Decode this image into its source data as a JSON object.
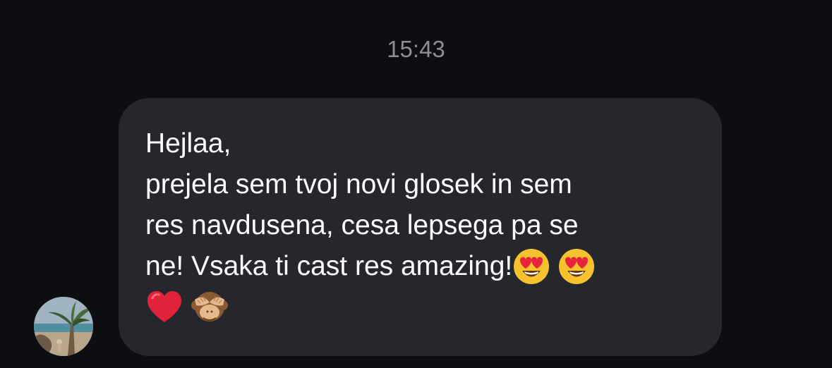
{
  "conversation": {
    "timestamp": "15:43"
  },
  "message": {
    "lines": [
      "Hejlaa,",
      "prejela sem tvoj novi glosek in sem",
      "res navdusena, cesa lepsega pa se",
      "ne! Vsaka ti cast res amazing!"
    ],
    "emojis_line4": [
      "heart-eyes-emoji",
      "heart-eyes-emoji"
    ],
    "emojis_line5": [
      "red-heart-emoji",
      "see-no-evil-monkey-emoji"
    ]
  },
  "colors": {
    "background": "#0d0e12",
    "bubble": "#26272c",
    "text": "#ffffff",
    "timestamp": "#8e8e93"
  }
}
